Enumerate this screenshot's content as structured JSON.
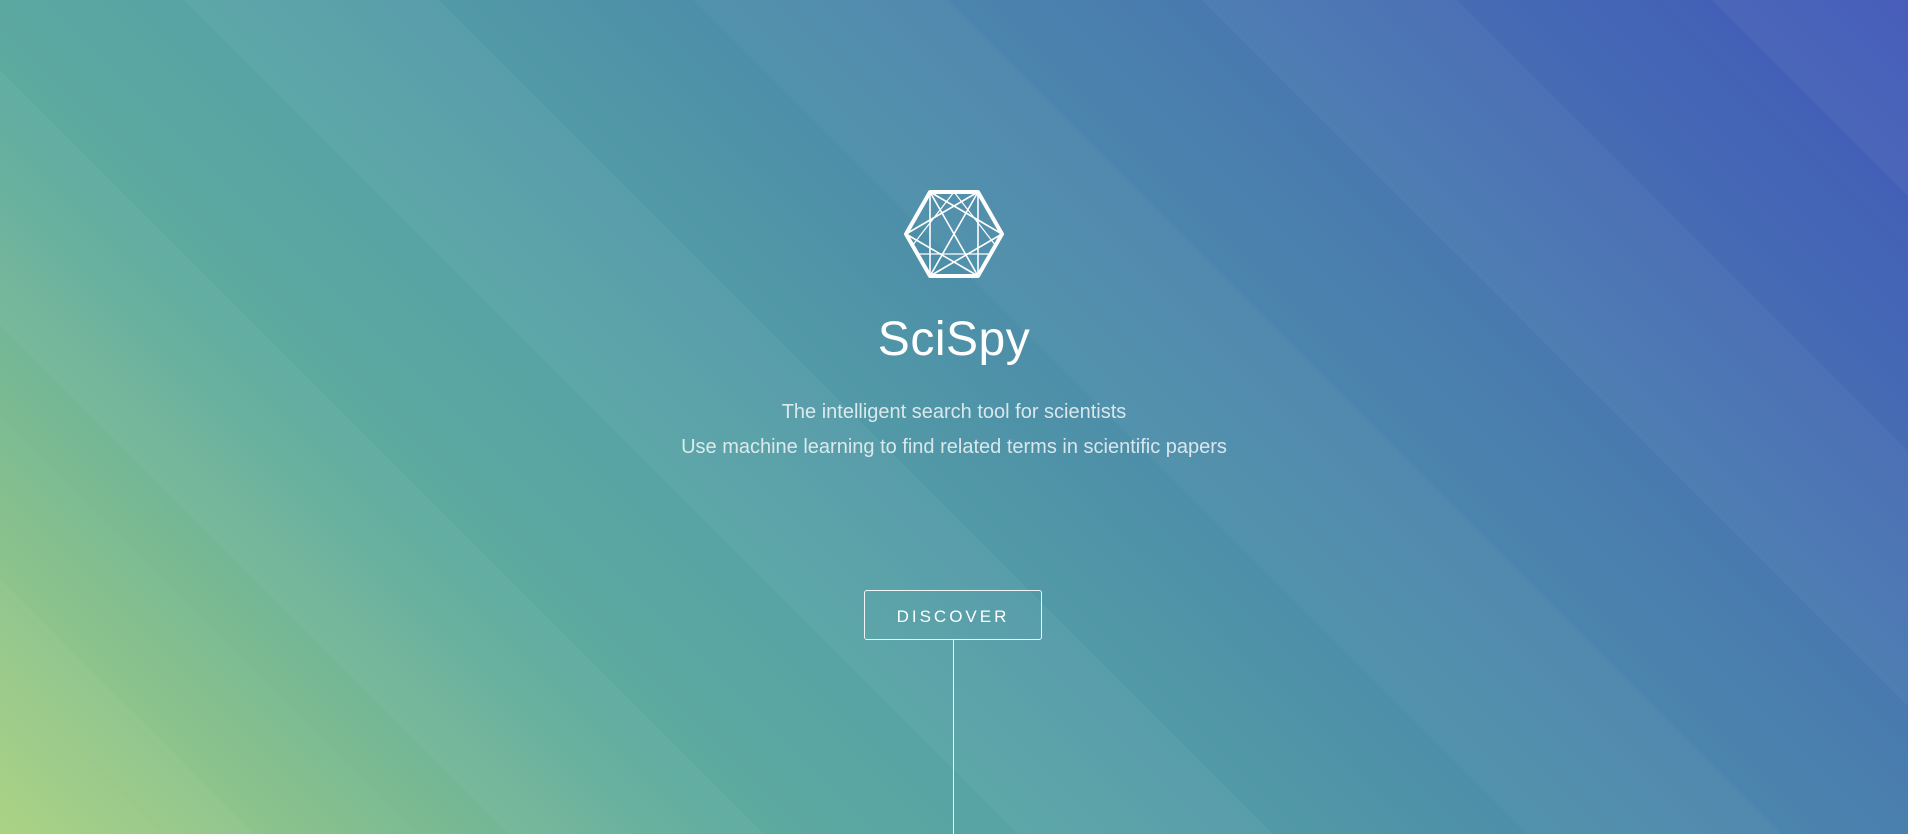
{
  "hero": {
    "logo_icon": "hexagon-network-icon",
    "title": "SciSpy",
    "subtitle_line1": "The intelligent search tool for scientists",
    "subtitle_line2": "Use machine learning to find related terms in scientific papers",
    "discover_label": "DISCOVER"
  },
  "colors": {
    "gradient_start": "#a8d180",
    "gradient_mid": "#56a1a6",
    "gradient_end": "#4158b8",
    "text": "#ffffff"
  }
}
